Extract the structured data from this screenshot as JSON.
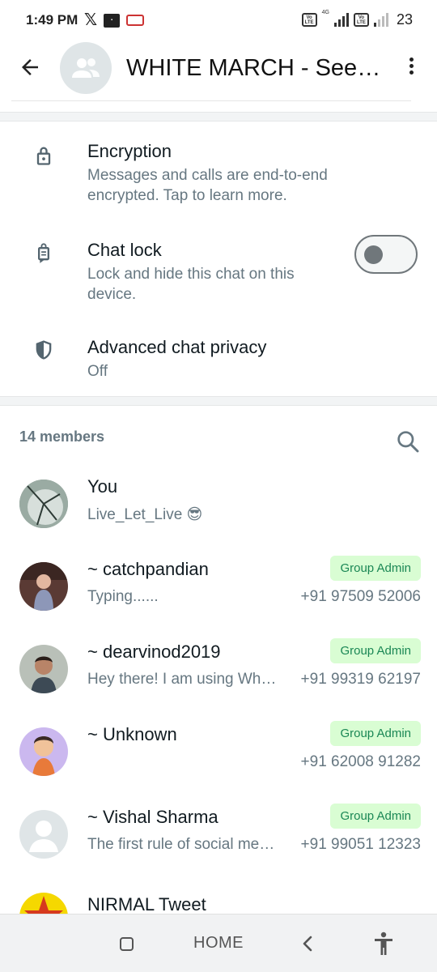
{
  "status_bar": {
    "time": "1:49 PM",
    "app_icons": [
      "x-icon",
      "paytm-icon",
      "bus-icon"
    ],
    "volte1": "Vo LTE",
    "network1": "4G",
    "volte2": "Vo LTE",
    "battery": "23"
  },
  "header": {
    "title": "WHITE MARCH - Seedi…",
    "back_icon": "arrow-back-icon",
    "menu_icon": "more-vert-icon"
  },
  "settings": {
    "encryption": {
      "label": "Encryption",
      "desc": "Messages and calls are end-to-end encrypted. Tap to learn more."
    },
    "chat_lock": {
      "label": "Chat lock",
      "desc": "Lock and hide this chat on this device.",
      "enabled": false
    },
    "advanced_privacy": {
      "label": "Advanced chat privacy",
      "value": "Off"
    }
  },
  "members": {
    "count_label": "14 members",
    "list": [
      {
        "name": "You",
        "about": "Live_Let_Live 😎",
        "badge": "",
        "phone": ""
      },
      {
        "name": "~ catchpandian",
        "about": "Typing......",
        "badge": "Group Admin",
        "phone": "+91 97509 52006"
      },
      {
        "name": "~ dearvinod2019",
        "about": "Hey there! I am using WhatsApp.",
        "badge": "Group Admin",
        "phone": "+91 99319 62197"
      },
      {
        "name": "~ Unknown",
        "about": "",
        "badge": "Group Admin",
        "phone": "+91 62008 91282"
      },
      {
        "name": "~ Vishal Sharma",
        "about": "The first rule of social media…",
        "badge": "Group Admin",
        "phone": "+91 99051 12323"
      },
      {
        "name": "NIRMAL Tweet",
        "about": "",
        "badge": "",
        "phone": ""
      }
    ]
  },
  "navbar": {
    "home_label": "HOME"
  },
  "colors": {
    "secondary_text": "#667781",
    "badge_bg": "#d9fdd3",
    "badge_text": "#1b8755"
  }
}
